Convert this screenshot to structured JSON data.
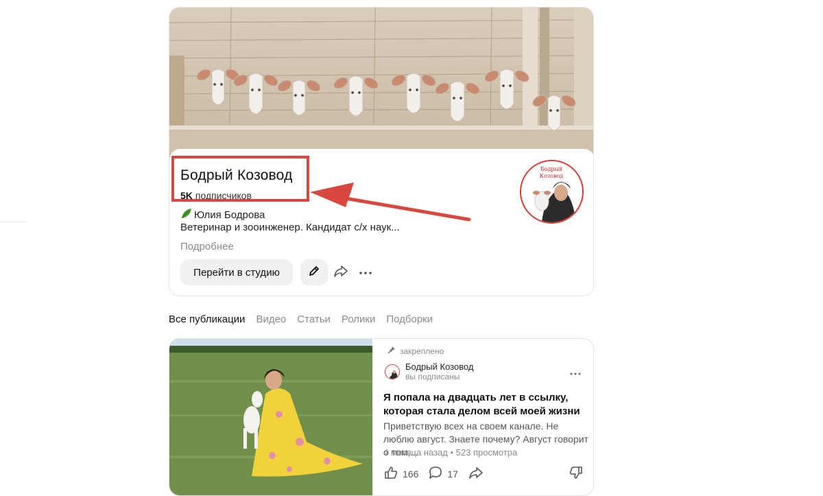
{
  "channel": {
    "name": "Бодрый Козовод",
    "subscribers_count": "5K",
    "subscribers_label": "подписчиков",
    "author": "Юлия Бодрова",
    "description": "Ветеринар и зооинженер. Кандидат с/х наук...",
    "more_link": "Подробнее",
    "studio_button": "Перейти в студию",
    "avatar_caption": "Бодрый Козовод",
    "icons": {
      "author_leaf": "leaf-icon",
      "edit": "pencil-icon",
      "share": "share-arrow-icon",
      "more": "more-dots-icon"
    }
  },
  "tabs": [
    {
      "label": "Все публикации",
      "active": true
    },
    {
      "label": "Видео",
      "active": false
    },
    {
      "label": "Статьи",
      "active": false
    },
    {
      "label": "Ролики",
      "active": false
    },
    {
      "label": "Подборки",
      "active": false
    }
  ],
  "post": {
    "pinned_label": "закреплено",
    "author_name": "Бодрый Козовод",
    "author_status": "вы подписаны",
    "title": "Я попала на двадцать лет в ссылку, которая стала делом всей моей жизни",
    "snippet": "Приветствую всех на своем канале. Не люблю август. Знаете почему? Август говорит о том,...",
    "meta": "4 месяца назад • 523 просмотра",
    "likes": "166",
    "comments": "17",
    "icons": {
      "pin": "pin-icon",
      "like": "thumbs-up-icon",
      "comment": "comment-icon",
      "share": "share-arrow-icon",
      "dislike": "thumbs-down-icon"
    }
  },
  "colors": {
    "annotation_red": "#d9483e",
    "avatar_ring": "#e3342f",
    "button_bg": "#f0f0f2",
    "muted_text": "#8a8a8a"
  }
}
